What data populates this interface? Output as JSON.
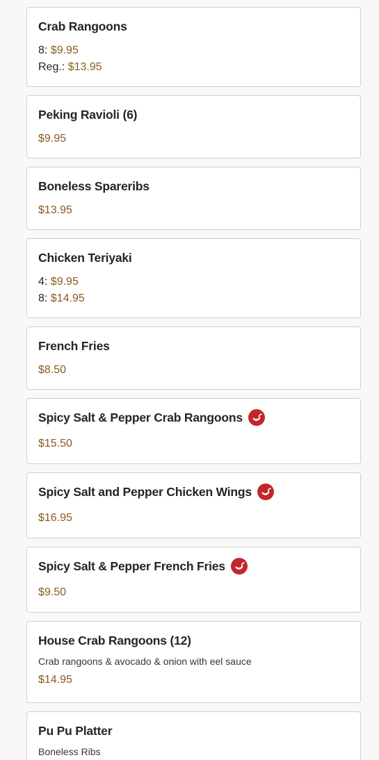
{
  "menu": {
    "items": [
      {
        "name": "Crab Rangoons",
        "spicy": false,
        "prices": [
          {
            "label": "8:",
            "amount": "$9.95"
          },
          {
            "label": "Reg.:",
            "amount": "$13.95"
          }
        ]
      },
      {
        "name": "Peking Ravioli (6)",
        "spicy": false,
        "prices": [
          {
            "label": "",
            "amount": "$9.95"
          }
        ]
      },
      {
        "name": "Boneless Spareribs",
        "spicy": false,
        "prices": [
          {
            "label": "",
            "amount": "$13.95"
          }
        ]
      },
      {
        "name": "Chicken Teriyaki",
        "spicy": false,
        "prices": [
          {
            "label": "4:",
            "amount": "$9.95"
          },
          {
            "label": "8:",
            "amount": "$14.95"
          }
        ]
      },
      {
        "name": "French Fries",
        "spicy": false,
        "prices": [
          {
            "label": "",
            "amount": "$8.50"
          }
        ]
      },
      {
        "name": "Spicy Salt & Pepper Crab Rangoons",
        "spicy": true,
        "prices": [
          {
            "label": "",
            "amount": "$15.50"
          }
        ]
      },
      {
        "name": "Spicy Salt and Pepper Chicken Wings",
        "spicy": true,
        "prices": [
          {
            "label": "",
            "amount": "$16.95"
          }
        ]
      },
      {
        "name": "Spicy Salt & Pepper French Fries",
        "spicy": true,
        "prices": [
          {
            "label": "",
            "amount": "$9.50"
          }
        ]
      },
      {
        "name": "House Crab Rangoons (12)",
        "spicy": false,
        "description": "Crab rangoons & avocado & onion with eel sauce",
        "prices": [
          {
            "label": "",
            "amount": "$14.95"
          }
        ]
      },
      {
        "name": "Pu Pu Platter",
        "spicy": false,
        "description": "Boneless Ribs",
        "prices": []
      }
    ]
  },
  "colors": {
    "price": "#8a5a1c",
    "spicy_icon": "#c3262b",
    "card_border": "#cfcfcf",
    "page_background": "#faf8f6"
  },
  "icons": {
    "spicy": "chili-pepper-icon"
  }
}
